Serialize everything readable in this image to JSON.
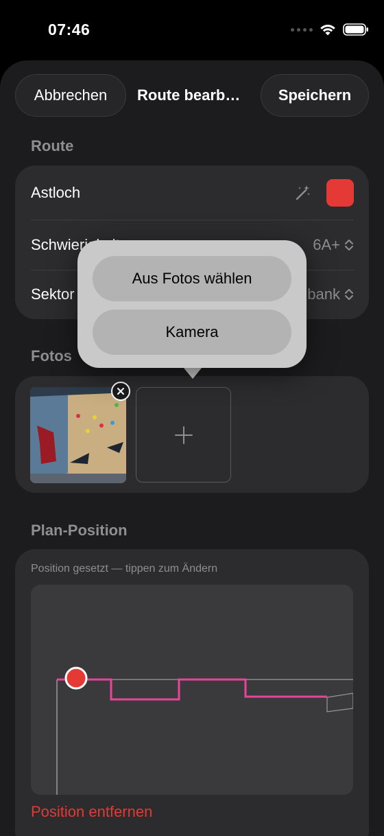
{
  "status": {
    "time": "07:46"
  },
  "nav": {
    "cancel": "Abbrechen",
    "title": "Route bearb…",
    "save": "Speichern"
  },
  "route_section": {
    "label": "Route",
    "name": "Astloch",
    "difficulty_label": "Schwierigkeit",
    "difficulty_value": "6A+",
    "sector_label": "Sektor",
    "sector_value": "bank",
    "color": "#e53935"
  },
  "photos_section": {
    "label": "Fotos"
  },
  "plan_section": {
    "label": "Plan-Position",
    "hint": "Position gesetzt — tippen zum Ändern",
    "remove": "Position entfernen"
  },
  "popover": {
    "choose_photos": "Aus Fotos wählen",
    "camera": "Kamera"
  },
  "colors": {
    "accent_red": "#e53935",
    "plan_line": "#e8459a",
    "sheet_bg": "#1c1c1e",
    "card_bg": "#2c2c2e"
  }
}
